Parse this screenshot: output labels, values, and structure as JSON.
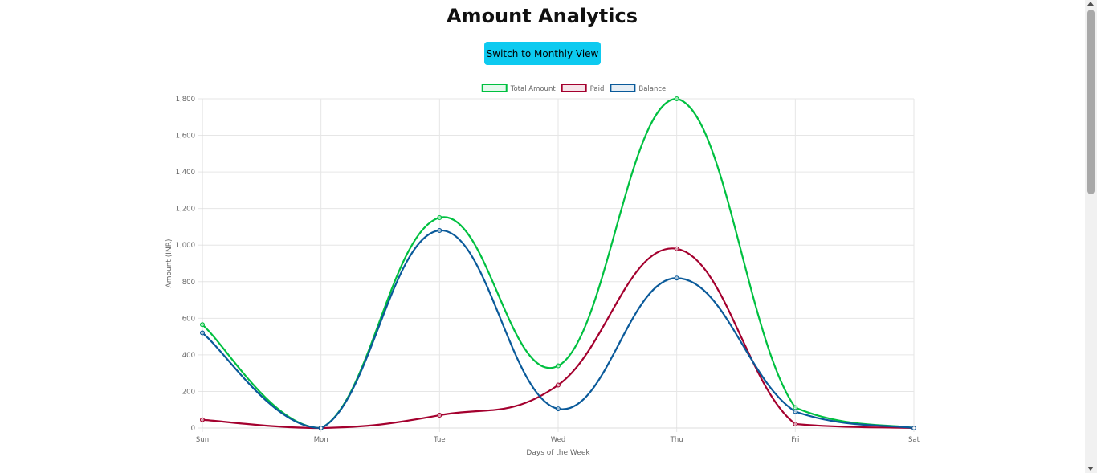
{
  "page": {
    "title": "Amount Analytics",
    "toggle_button_label": "Switch to Monthly View"
  },
  "chart_data": {
    "type": "line",
    "categories": [
      "Sun",
      "Mon",
      "Tue",
      "Wed",
      "Thu",
      "Fri",
      "Sat"
    ],
    "series": [
      {
        "name": "Total Amount",
        "color": "#00c040",
        "values": [
          565,
          0,
          1150,
          340,
          1800,
          112,
          0
        ]
      },
      {
        "name": "Paid",
        "color": "#a4002e",
        "values": [
          45,
          0,
          70,
          235,
          980,
          22,
          0
        ]
      },
      {
        "name": "Balance",
        "color": "#0a5a9a",
        "values": [
          520,
          0,
          1080,
          105,
          820,
          90,
          0
        ]
      }
    ],
    "xlabel": "Days of the Week",
    "ylabel": "Amount (INR)",
    "ylim": [
      0,
      1800
    ],
    "yticks": [
      "0",
      "200",
      "400",
      "600",
      "800",
      "1,000",
      "1,200",
      "1,400",
      "1,600",
      "1,800"
    ],
    "grid": true,
    "legend": "top-center",
    "curve": "smooth"
  }
}
